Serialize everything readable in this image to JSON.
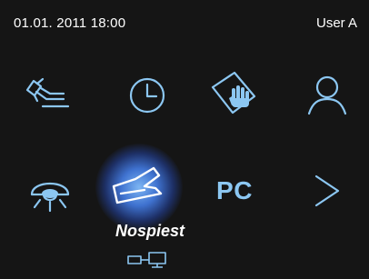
{
  "status": {
    "datetime": "01.01. 2011 18:00",
    "user": "User A"
  },
  "menu": {
    "row1": [
      {
        "icon": "dental-handpiece-icon"
      },
      {
        "icon": "clock-icon"
      },
      {
        "icon": "touch-hand-icon"
      },
      {
        "icon": "user-icon"
      }
    ],
    "row2": [
      {
        "icon": "operating-light-icon"
      },
      {
        "icon": "foot-control-icon",
        "selected": true
      },
      {
        "label": "PC"
      },
      {
        "icon": "chevron-right-icon"
      }
    ],
    "selected_label": "Nospiest"
  },
  "footer": {
    "icon": "network-connection-icon"
  },
  "colors": {
    "accent": "#8cc7f2",
    "background": "#151515",
    "text": "#ffffff",
    "selection_glow": "#4a82f0"
  }
}
